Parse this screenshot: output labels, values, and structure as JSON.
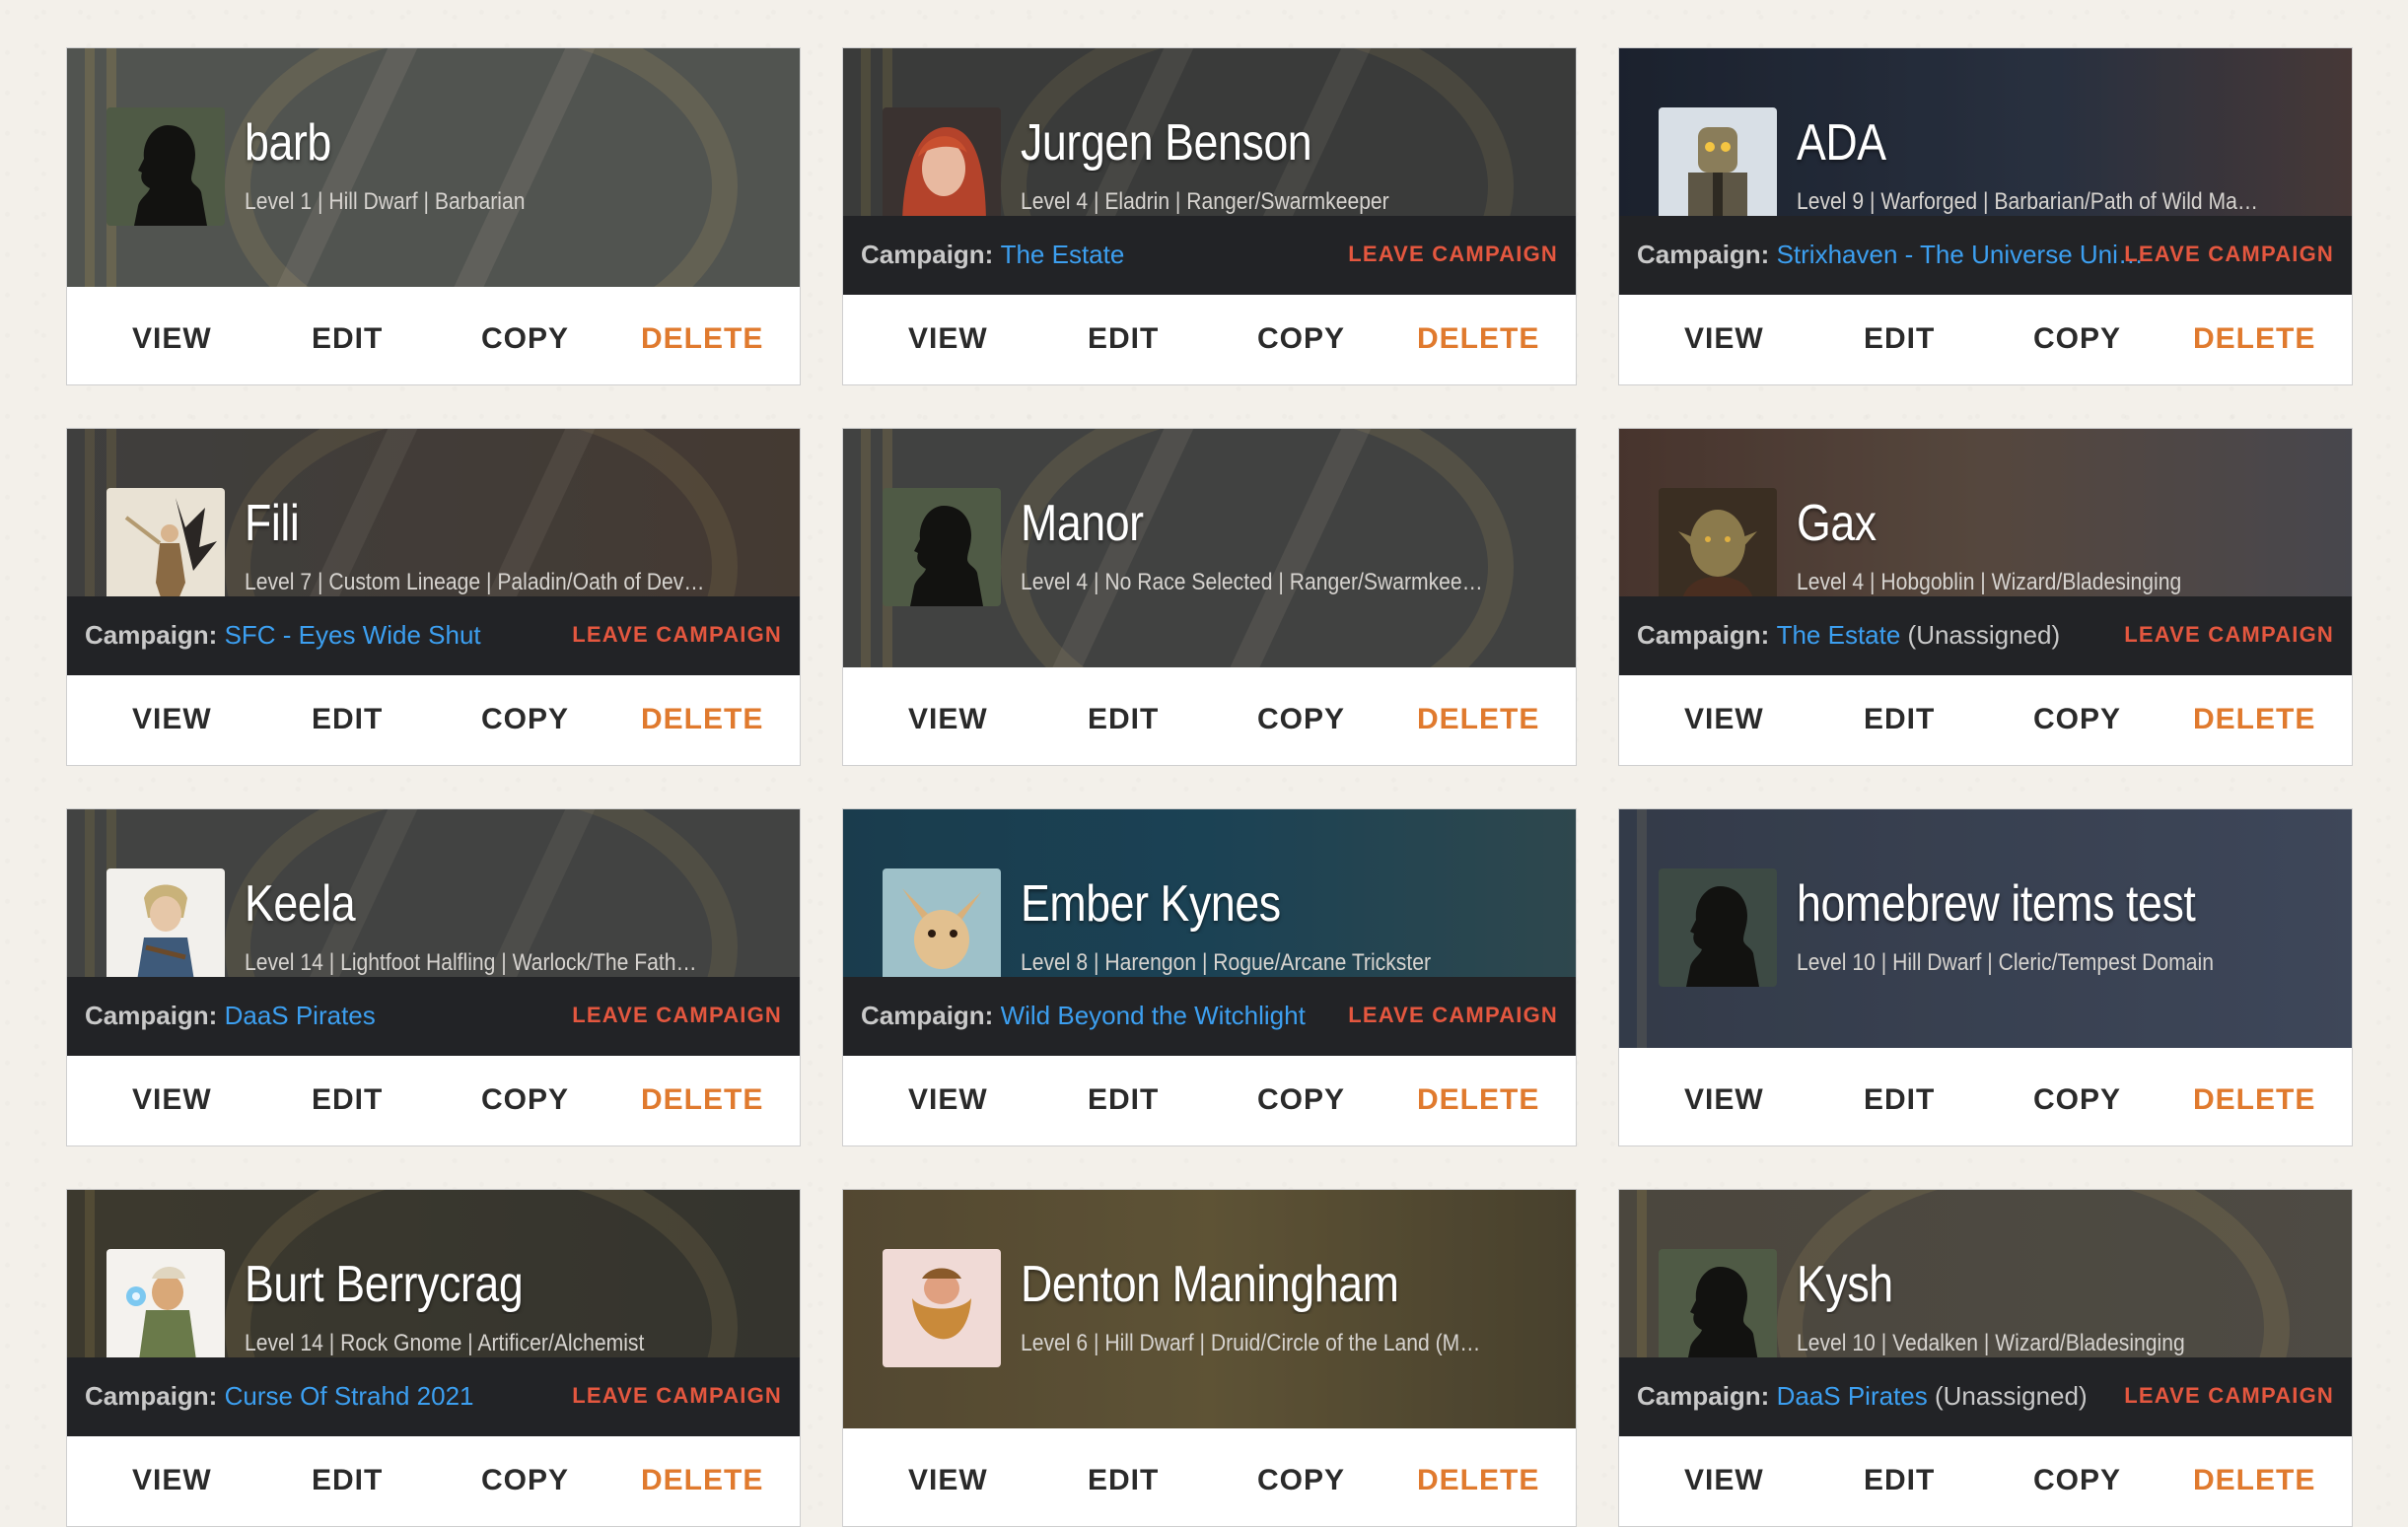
{
  "actions": {
    "view": "VIEW",
    "edit": "EDIT",
    "copy": "COPY",
    "delete": "DELETE"
  },
  "campaign_label": "Campaign:",
  "leave_label": "LEAVE CAMPAIGN",
  "characters": [
    {
      "name": "barb",
      "details": "Level 1 | Hill Dwarf | Barbarian",
      "avatar": "silhouette-portrait",
      "campaign": null
    },
    {
      "name": "Jurgen Benson",
      "details": "Level 4 | Eladrin | Ranger/Swarmkeeper",
      "avatar": "red-haired-elf-portrait",
      "campaign": {
        "name": "The Estate",
        "extra": ""
      }
    },
    {
      "name": "ADA",
      "details": "Level 9 | Warforged | Barbarian/Path of Wild Ma…",
      "avatar": "robot-portrait",
      "campaign": {
        "name": "Strixhaven - The Universe Uni…",
        "extra": ""
      }
    },
    {
      "name": "Fili",
      "details": "Level 7 | Custom Lineage | Paladin/Oath of Dev…",
      "avatar": "winged-warrior-portrait",
      "campaign": {
        "name": "SFC - Eyes Wide Shut",
        "extra": ""
      }
    },
    {
      "name": "Manor",
      "details": "Level 4 | No Race Selected | Ranger/Swarmkee…",
      "avatar": "silhouette-portrait",
      "campaign": null
    },
    {
      "name": "Gax",
      "details": "Level 4 | Hobgoblin | Wizard/Bladesinging",
      "avatar": "hobgoblin-portrait",
      "campaign": {
        "name": "The Estate",
        "extra": " (Unassigned)"
      }
    },
    {
      "name": "Keela",
      "details": "Level 14 | Lightfoot Halfling | Warlock/The Fath…",
      "avatar": "halfling-portrait",
      "campaign": {
        "name": "DaaS Pirates",
        "extra": ""
      }
    },
    {
      "name": "Ember Kynes",
      "details": "Level 8 | Harengon | Rogue/Arcane Trickster",
      "avatar": "rabbit-portrait",
      "campaign": {
        "name": "Wild Beyond the Witchlight",
        "extra": ""
      }
    },
    {
      "name": "homebrew items test",
      "details": "Level 10 | Hill Dwarf | Cleric/Tempest Domain",
      "avatar": "silhouette-portrait",
      "campaign": null
    },
    {
      "name": "Burt Berrycrag",
      "details": "Level 14 | Rock Gnome | Artificer/Alchemist",
      "avatar": "gnome-portrait",
      "campaign": {
        "name": "Curse Of Strahd 2021",
        "extra": ""
      }
    },
    {
      "name": "Denton Maningham",
      "details": "Level 6 | Hill Dwarf | Druid/Circle of the Land (M…",
      "avatar": "dwarf-portrait",
      "campaign": null
    },
    {
      "name": "Kysh",
      "details": "Level 10 | Vedalken | Wizard/Bladesinging",
      "avatar": "silhouette-portrait",
      "campaign": {
        "name": "DaaS Pirates",
        "extra": " (Unassigned)"
      }
    }
  ]
}
